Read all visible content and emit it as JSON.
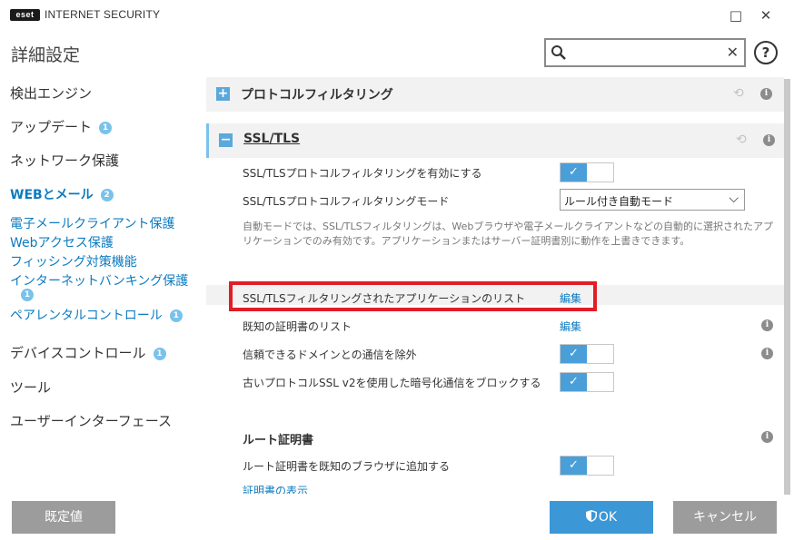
{
  "window": {
    "logo": "eset",
    "title": "INTERNET SECURITY",
    "minimize": "□",
    "close": "✕"
  },
  "page_title": "詳細設定",
  "search": {
    "value": "",
    "placeholder": "",
    "clear": "✕"
  },
  "help": "?",
  "sidebar": {
    "items": [
      {
        "label": "検出エンジン"
      },
      {
        "label": "アップデート",
        "badge": "1"
      },
      {
        "label": "ネットワーク保護"
      },
      {
        "label": "WEBとメール",
        "badge": "2"
      },
      {
        "label": "デバイスコントロール",
        "badge": "1"
      },
      {
        "label": "ツール"
      },
      {
        "label": "ユーザーインターフェース"
      }
    ],
    "subitems": [
      {
        "label": "電子メールクライアント保護"
      },
      {
        "label": "Webアクセス保護"
      },
      {
        "label": "フィッシング対策機能"
      },
      {
        "label": "インターネットバンキング保護",
        "badge": "1"
      },
      {
        "label": "ペアレンタルコントロール",
        "badge": "1"
      }
    ]
  },
  "sections": {
    "protocol": {
      "toggle": "+",
      "title": "プロトコルフィルタリング"
    },
    "ssl": {
      "toggle": "−",
      "title": "SSL/TLS"
    }
  },
  "ssl_rows": {
    "enable": "SSL/TLSプロトコルフィルタリングを有効にする",
    "mode": "SSL/TLSプロトコルフィルタリングモード",
    "mode_value": "ルール付き自動モード",
    "description": "自動モードでは、SSL/TLSフィルタリングは、Webブラウザや電子メールクライアントなどの自動的に選択されたアプリケーションでのみ有効です。アプリケーションまたはサーバー証明書別に動作を上書きできます。",
    "app_list": "SSL/TLSフィルタリングされたアプリケーションのリスト",
    "cert_list": "既知の証明書のリスト",
    "exclude_trusted": "信頼できるドメインとの通信を除外",
    "block_sslv2": "古いプロトコルSSL v2を使用した暗号化通信をブロックする",
    "root_cert_heading": "ルート証明書",
    "add_root_cert": "ルート証明書を既知のブラウザに追加する",
    "show_cert": "証明書の表示"
  },
  "links": {
    "edit": "編集"
  },
  "icons": {
    "info": "i",
    "revert": "⟲",
    "check": "✓",
    "chevron": "⌵"
  },
  "toggles": {
    "enable": true,
    "exclude_trusted": true,
    "block_sslv2": true,
    "add_root_cert": true
  },
  "footer": {
    "default_label": "既定値",
    "ok_label": "OK",
    "cancel_label": "キャンセル"
  },
  "colors": {
    "accent": "#0c7bc1",
    "toggle_on": "#4b9fd8",
    "badge": "#79c2ec",
    "highlight": "#e11d27"
  }
}
